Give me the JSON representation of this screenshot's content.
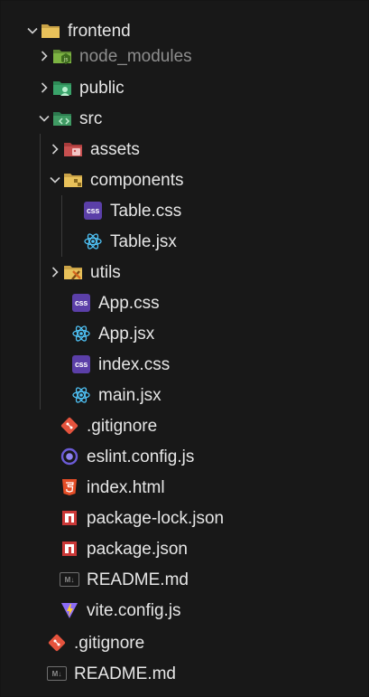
{
  "tree": [
    {
      "label": "frontend",
      "chevron": "open",
      "icon": "folder-icon"
    },
    {
      "label": "node_modules",
      "chevron": "closed",
      "icon": "node-modules-folder-icon",
      "dim": true
    },
    {
      "label": "public",
      "chevron": "closed",
      "icon": "public-folder-icon"
    },
    {
      "label": "src",
      "chevron": "open",
      "icon": "src-folder-icon"
    },
    {
      "label": "assets",
      "chevron": "closed",
      "icon": "assets-folder-icon"
    },
    {
      "label": "components",
      "chevron": "open",
      "icon": "components-folder-icon"
    },
    {
      "label": "Table.css",
      "icon": "css-icon"
    },
    {
      "label": "Table.jsx",
      "icon": "react-icon"
    },
    {
      "label": "utils",
      "chevron": "closed",
      "icon": "utils-folder-icon"
    },
    {
      "label": "App.css",
      "icon": "css-icon"
    },
    {
      "label": "App.jsx",
      "icon": "react-icon"
    },
    {
      "label": "index.css",
      "icon": "css-icon"
    },
    {
      "label": "main.jsx",
      "icon": "react-icon"
    },
    {
      "label": ".gitignore",
      "icon": "git-icon"
    },
    {
      "label": "eslint.config.js",
      "icon": "eslint-icon"
    },
    {
      "label": "index.html",
      "icon": "html5-icon"
    },
    {
      "label": "package-lock.json",
      "icon": "npm-icon"
    },
    {
      "label": "package.json",
      "icon": "npm-icon"
    },
    {
      "label": "README.md",
      "icon": "markdown-icon"
    },
    {
      "label": "vite.config.js",
      "icon": "vite-icon"
    },
    {
      "label": ".gitignore",
      "icon": "git-icon"
    },
    {
      "label": "README.md",
      "icon": "markdown-icon"
    }
  ],
  "badges": {
    "css": "css",
    "markdown": "M↓"
  },
  "colors": {
    "background": "#181818",
    "text": "#e6e6e6",
    "dim_text": "#8d8d8d",
    "guide": "#3a3a3a",
    "folder_yellow": "#e8c15a",
    "node_green": "#7cb342",
    "css_purple": "#5b3fa8",
    "react_cyan": "#4fc3f7",
    "git_orange": "#e5533d",
    "eslint_purple": "#6b5bd6",
    "html_orange": "#e44d26",
    "npm_red": "#cb3837",
    "vite_purple": "#8b6cf7",
    "vite_yellow": "#ffcc33"
  }
}
